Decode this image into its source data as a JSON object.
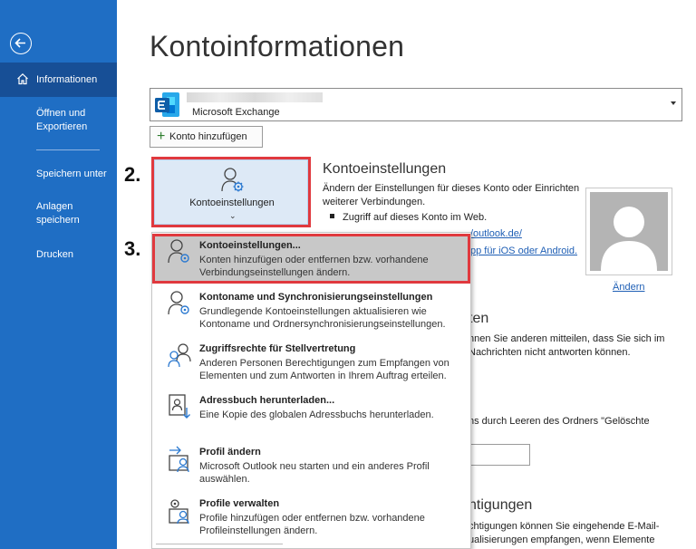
{
  "sidebar": {
    "back_icon": "arrow-left-circle-icon",
    "items": [
      {
        "label": "Informationen",
        "icon": "home-icon",
        "active": true
      },
      {
        "label": "Öffnen und Exportieren"
      },
      {
        "label": "Speichern unter"
      },
      {
        "label": "Anlagen speichern"
      },
      {
        "label": "Drucken"
      }
    ]
  },
  "page": {
    "title": "Kontoinformationen"
  },
  "account": {
    "type": "Microsoft Exchange",
    "icon": "exchange-icon"
  },
  "add_account": {
    "label": "Konto hinzufügen"
  },
  "steps": {
    "two": "2.",
    "three": "3."
  },
  "settings_button": {
    "label": "Kontoeinstellungen",
    "chevron": "⌄"
  },
  "account_settings_section": {
    "heading": "Kontoeinstellungen",
    "description": "Ändern der Einstellungen für dieses Konto oder Einrichten weiterer Verbindungen.",
    "bullet": "Zugriff auf dieses Konto im Web.",
    "link1": "/outlook.de/",
    "link2": "pp für iOS oder Android."
  },
  "photo": {
    "change_label": "Ändern"
  },
  "background": {
    "heading2": "ten",
    "text2": "nnen Sie anderen mitteilen, dass Sie sich im\nNachrichten nicht antworten können.",
    "text3": "ns durch Leeren des Ordners \"Gelöschte",
    "heading4": "ntigungen",
    "text4": "chtigungen können Sie eingehende E-Mail-\nualisierungen empfangen, wenn Elemente"
  },
  "menu": {
    "items": [
      {
        "title": "Kontoeinstellungen...",
        "description": "Konten hinzufügen oder entfernen bzw. vorhandene Verbindungseinstellungen ändern.",
        "highlighted": true
      },
      {
        "title": "Kontoname und Synchronisierungseinstellungen",
        "description": "Grundlegende Kontoeinstellungen aktualisieren wie Kontoname und Ordnersynchronisierungseinstellungen."
      },
      {
        "title": "Zugriffsrechte für Stellvertretung",
        "description": "Anderen Personen Berechtigungen zum Empfangen von Elementen und zum Antworten in Ihrem Auftrag erteilen."
      },
      {
        "title": "Adressbuch herunterladen...",
        "description": "Eine Kopie des globalen Adressbuchs herunterladen."
      },
      {
        "title": "Profil ändern",
        "description": "Microsoft Outlook neu starten und ein anderes Profil auswählen."
      },
      {
        "title": "Profile verwalten",
        "description": "Profile hinzufügen oder entfernen bzw. vorhandene Profileinstellungen ändern."
      }
    ]
  },
  "colors": {
    "sidebar": "#1f6ec4",
    "sidebar_active": "#174f96",
    "highlight_border": "#e0393e",
    "link": "#1f5fb5"
  }
}
